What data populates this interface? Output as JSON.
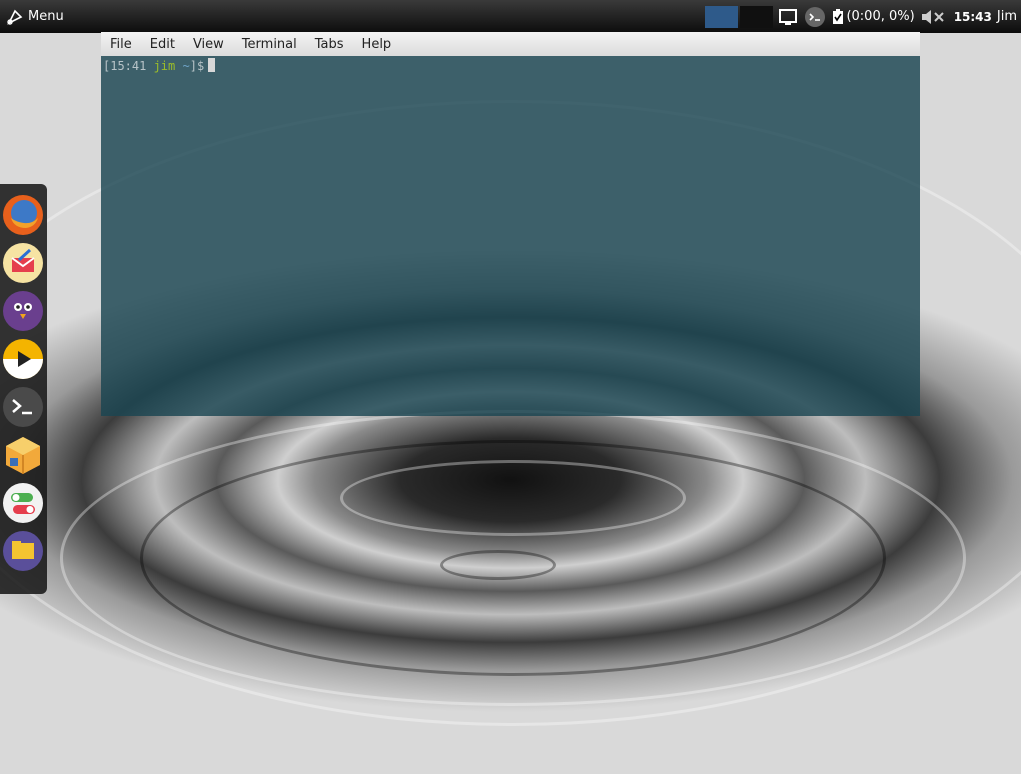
{
  "panel": {
    "menu_label": "Menu",
    "battery_text": "(0:00, 0%)",
    "clock": "15:43",
    "user": "Jim"
  },
  "terminal": {
    "menu": [
      "File",
      "Edit",
      "View",
      "Terminal",
      "Tabs",
      "Help"
    ],
    "prompt": {
      "open": "[15:41 ",
      "user": "jim",
      "dir": " ~",
      "close": "]$"
    }
  },
  "dock": {
    "items": [
      "firefox-icon",
      "mail-icon",
      "pidgin-icon",
      "media-player-icon",
      "terminal-icon",
      "software-center-icon",
      "settings-toggle-icon",
      "file-manager-icon"
    ]
  },
  "colors": {
    "terminal_bg": "#1b4652",
    "prompt_user": "#9bbd2a",
    "workspace_active": "#2e5a8a"
  }
}
